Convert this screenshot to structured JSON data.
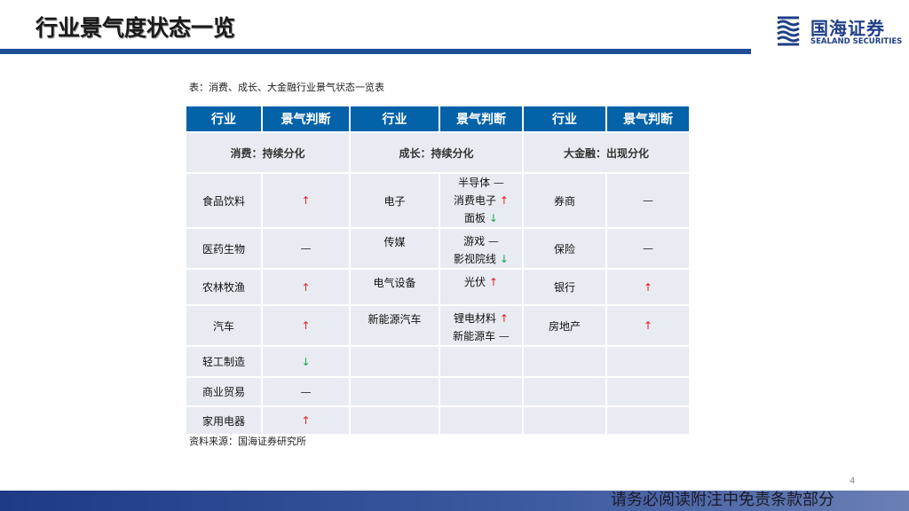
{
  "header": {
    "title": "行业景气度状态一览"
  },
  "logo": {
    "cn": "国海证券",
    "en": "SEALAND SECURITIES"
  },
  "caption": "表：消费、成长、大金融行业景气状态一览表",
  "symbols": {
    "up": "↑",
    "down": "↓",
    "flat": "—"
  },
  "colors": {
    "header_bg": "#0462a8",
    "up": "#e81c1c",
    "down": "#1aa447",
    "cell_bg": "#e8ebf2"
  },
  "table": {
    "headers": [
      "行业",
      "景气判断",
      "行业",
      "景气判断",
      "行业",
      "景气判断"
    ],
    "sections": [
      "消费：持续分化",
      "成长：持续分化",
      "大金融：出现分化"
    ],
    "rows": [
      {
        "consumer": {
          "name": "食品饮料",
          "trend": "up"
        },
        "growth": {
          "name": "电子",
          "items": [
            {
              "name": "半导体",
              "trend": "flat"
            },
            {
              "name": "消费电子",
              "trend": "up"
            },
            {
              "name": "面板",
              "trend": "down"
            }
          ]
        },
        "finance": {
          "name": "券商",
          "trend": "flat"
        }
      },
      {
        "consumer": {
          "name": "医药生物",
          "trend": "flat"
        },
        "growth": {
          "name": "传媒",
          "top": true,
          "items": [
            {
              "name": "游戏",
              "trend": "flat"
            },
            {
              "name": "影视院线",
              "trend": "down"
            }
          ]
        },
        "finance": {
          "name": "保险",
          "trend": "flat"
        }
      },
      {
        "consumer": {
          "name": "农林牧渔",
          "trend": "up"
        },
        "growth": {
          "name": "电气设备",
          "top": true,
          "items": [
            {
              "name": "光伏",
              "trend": "up"
            }
          ]
        },
        "finance": {
          "name": "银行",
          "trend": "up"
        }
      },
      {
        "consumer": {
          "name": "汽车",
          "trend": "up"
        },
        "growth": {
          "name": "新能源汽车",
          "top": true,
          "items": [
            {
              "name": "锂电材料",
              "trend": "up"
            },
            {
              "name": "新能源车",
              "trend": "flat"
            }
          ]
        },
        "finance": {
          "name": "房地产",
          "trend": "up"
        }
      },
      {
        "consumer": {
          "name": "轻工制造",
          "trend": "down"
        }
      },
      {
        "consumer": {
          "name": "商业贸易",
          "trend": "flat"
        }
      },
      {
        "consumer": {
          "name": "家用电器",
          "trend": "up"
        }
      }
    ]
  },
  "source": "资料来源：国海证券研究所",
  "page_number": "4",
  "footer": "请务必阅读附注中免责条款部分"
}
